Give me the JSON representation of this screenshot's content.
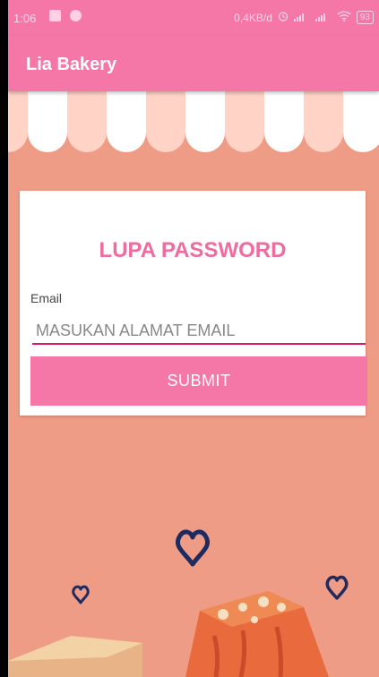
{
  "status_bar": {
    "time": "1:06",
    "network_speed": "0,4KB/d",
    "battery": "93"
  },
  "app_bar": {
    "title": "Lia Bakery"
  },
  "form": {
    "title": "LUPA PASSWORD",
    "email_label": "Email",
    "email_placeholder": "MASUKAN ALAMAT EMAIL",
    "email_value": "",
    "submit_label": "SUBMIT"
  },
  "colors": {
    "primary": "#f477a8",
    "accent": "#d81b60",
    "title_text": "#f06b9f",
    "background": "#ee9c86"
  },
  "icons": [
    "image-icon",
    "notification-icon",
    "alarm-icon",
    "signal-icon",
    "wifi-icon",
    "battery-icon",
    "heart-icon"
  ]
}
